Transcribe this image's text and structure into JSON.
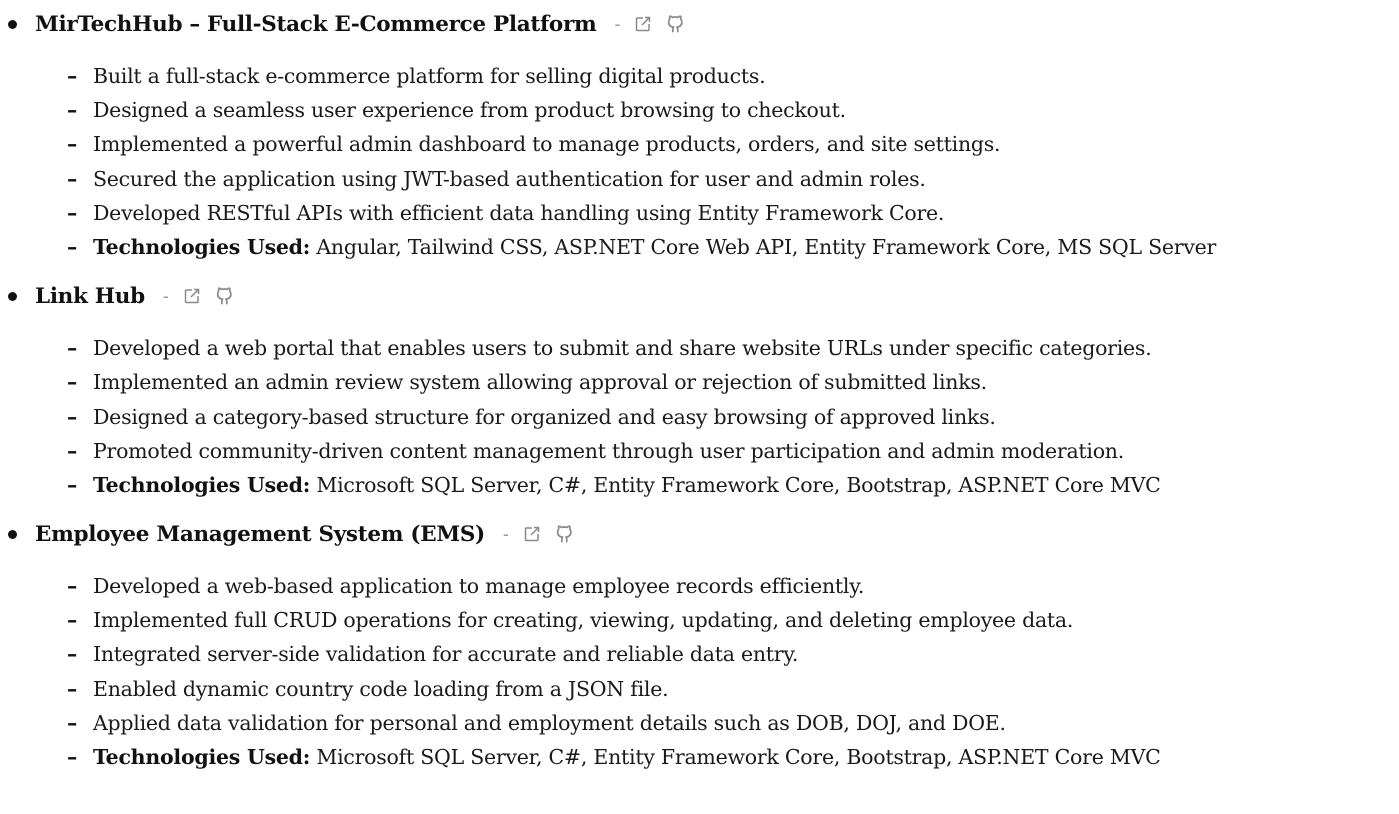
{
  "projects": [
    {
      "title": "MirTechHub – Full-Stack E-Commerce Platform",
      "separator": "-",
      "icons": [
        "external-link-icon",
        "github-icon"
      ],
      "items": [
        "Built a full-stack e-commerce platform for selling digital products.",
        "Designed a seamless user experience from product browsing to checkout.",
        "Implemented a powerful admin dashboard to manage products, orders, and site settings.",
        "Secured the application using JWT-based authentication for user and admin roles.",
        "Developed RESTful APIs with efficient data handling using Entity Framework Core."
      ],
      "tech_label": "Technologies Used:",
      "tech_value": "Angular, Tailwind CSS, ASP.NET Core Web API, Entity Framework Core, MS SQL Server"
    },
    {
      "title": "Link Hub",
      "separator": "-",
      "icons": [
        "external-link-icon",
        "github-icon"
      ],
      "items": [
        "Developed a web portal that enables users to submit and share website URLs under specific categories.",
        "Implemented an admin review system allowing approval or rejection of submitted links.",
        "Designed a category-based structure for organized and easy browsing of approved links.",
        "Promoted community-driven content management through user participation and admin moderation."
      ],
      "tech_label": "Technologies Used:",
      "tech_value": "Microsoft SQL Server, C#, Entity Framework Core, Bootstrap, ASP.NET Core MVC"
    },
    {
      "title": "Employee Management System (EMS)",
      "separator": "-",
      "icons": [
        "external-link-icon",
        "github-icon"
      ],
      "items": [
        "Developed a web-based application to manage employee records efficiently.",
        "Implemented full CRUD operations for creating, viewing, updating, and deleting employee data.",
        "Integrated server-side validation for accurate and reliable data entry.",
        "Enabled dynamic country code loading from a JSON file.",
        "Applied data validation for personal and employment details such as DOB, DOJ, and DOE."
      ],
      "tech_label": "Technologies Used:",
      "tech_value": "Microsoft SQL Server, C#, Entity Framework Core, Bootstrap, ASP.NET Core MVC"
    }
  ],
  "dash": "–",
  "colors": {
    "text": "#1a1a1a",
    "icon": "#8a8a8a",
    "separator": "#9a9a9a"
  }
}
